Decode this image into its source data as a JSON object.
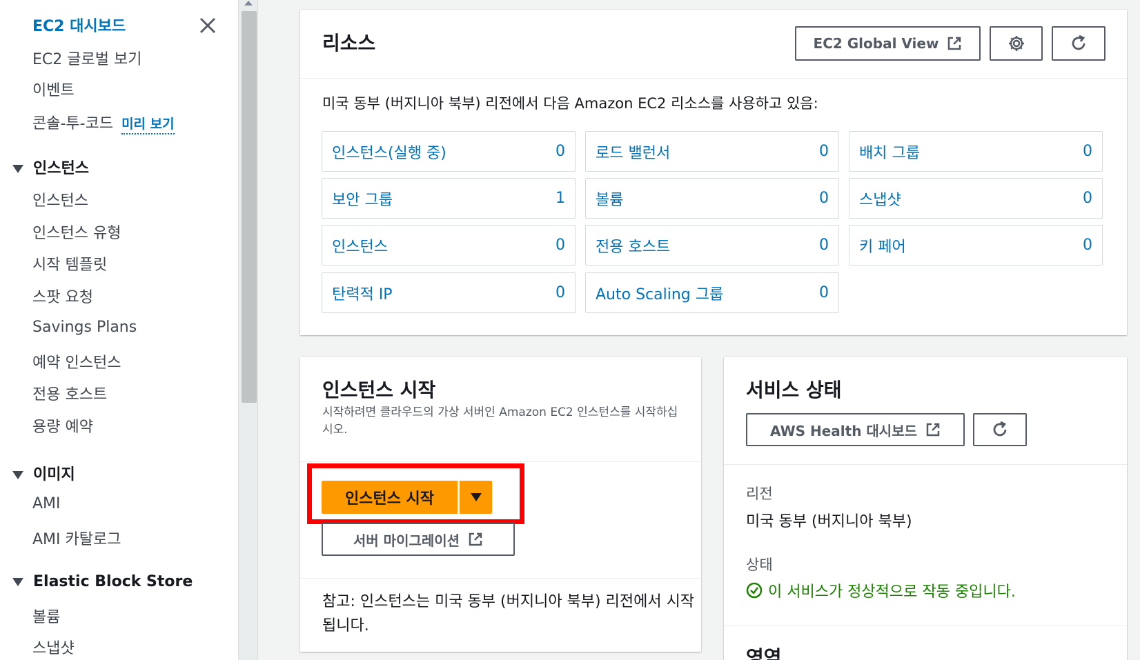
{
  "sidebar": {
    "top_links": [
      {
        "label": "EC2 대시보드"
      },
      {
        "label": "EC2 글로벌 보기"
      },
      {
        "label": "이벤트"
      },
      {
        "label": "콘솔-투-코드"
      }
    ],
    "preview_label": "미리 보기",
    "sections": [
      {
        "title": "인스턴스",
        "items": [
          "인스턴스",
          "인스턴스 유형",
          "시작 템플릿",
          "스팟 요청",
          "Savings Plans",
          "예약 인스턴스",
          "전용 호스트",
          "용량 예약"
        ]
      },
      {
        "title": "이미지",
        "items": [
          "AMI",
          "AMI 카탈로그"
        ]
      },
      {
        "title": "Elastic Block Store",
        "items": [
          "볼륨",
          "스냅샷"
        ]
      }
    ]
  },
  "resources": {
    "title": "리소스",
    "global_view_label": "EC2 Global View",
    "description": "미국 동부 (버지니아 북부) 리전에서 다음 Amazon EC2 리소스를 사용하고 있음:",
    "cells": [
      {
        "label": "인스턴스(실행 중)",
        "count": "0"
      },
      {
        "label": "로드 밸런서",
        "count": "0"
      },
      {
        "label": "배치 그룹",
        "count": "0"
      },
      {
        "label": "보안 그룹",
        "count": "1"
      },
      {
        "label": "볼륨",
        "count": "0"
      },
      {
        "label": "스냅샷",
        "count": "0"
      },
      {
        "label": "인스턴스",
        "count": "0"
      },
      {
        "label": "전용 호스트",
        "count": "0"
      },
      {
        "label": "키 페어",
        "count": "0"
      },
      {
        "label": "탄력적 IP",
        "count": "0"
      },
      {
        "label": "Auto Scaling 그룹",
        "count": "0"
      }
    ]
  },
  "launch": {
    "title": "인스턴스 시작",
    "description": "시작하려면 클라우드의 가상 서버인 Amazon EC2 인스턴스를 시작하십시오.",
    "launch_button": "인스턴스 시작",
    "migration_button": "서버 마이그레이션",
    "note": "참고: 인스턴스는 미국 동부 (버지니아 북부) 리전에서 시작됩니다."
  },
  "service_health": {
    "title": "서비스 상태",
    "health_dashboard_button": "AWS Health 대시보드",
    "region_label": "리전",
    "region_value": "미국 동부 (버지니아 북부)",
    "status_label": "상태",
    "status_value": "이 서비스가 정상적으로 작동 중입니다.",
    "zones_title": "영역"
  },
  "colors": {
    "link": "#0073bb",
    "primary_button": "#ff9900",
    "highlight": "#ff0000",
    "success": "#1d8102"
  }
}
